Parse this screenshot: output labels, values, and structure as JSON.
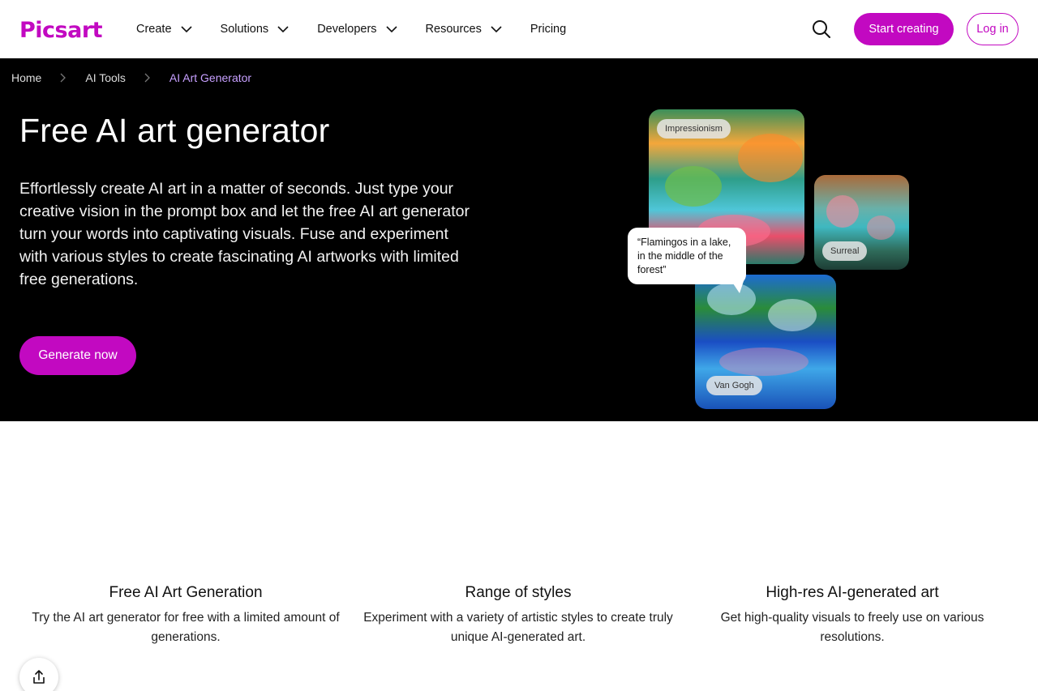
{
  "brand": {
    "logo_text": "Picsart",
    "accent": "#c209c1",
    "breadcrumb_active": "#c7a0ff"
  },
  "nav": {
    "items": [
      {
        "label": "Create",
        "has_dropdown": true
      },
      {
        "label": "Solutions",
        "has_dropdown": true
      },
      {
        "label": "Developers",
        "has_dropdown": true
      },
      {
        "label": "Resources",
        "has_dropdown": true
      },
      {
        "label": "Pricing",
        "has_dropdown": false
      }
    ],
    "search_icon": "search-icon",
    "start_label": "Start creating",
    "login_label": "Log in"
  },
  "breadcrumb": [
    "Home",
    "AI Tools",
    "AI Art Generator"
  ],
  "hero": {
    "title": "Free AI art generator",
    "description": "Effortlessly create AI art in a matter of seconds. Just type your creative vision in the prompt box and let the free AI art generator turn your words into captivating visuals. Fuse and experiment with various styles to create fascinating AI artworks with limited free generations.",
    "cta_label": "Generate now",
    "collage": {
      "tags": [
        "Impressionism",
        "Surreal",
        "Van Gogh"
      ],
      "prompt": "“Flamingos in a lake, in the middle of the forest”"
    }
  },
  "features": [
    {
      "title": "Free AI Art Generation",
      "description": "Try the AI art generator for free with a limited amount of generations."
    },
    {
      "title": "Range of styles",
      "description": "Experiment with a variety of artistic styles to create truly unique AI-generated art."
    },
    {
      "title": "High-res AI-generated art",
      "description": "Get high-quality visuals to freely use on various resolutions."
    }
  ],
  "share_icon": "share-icon"
}
